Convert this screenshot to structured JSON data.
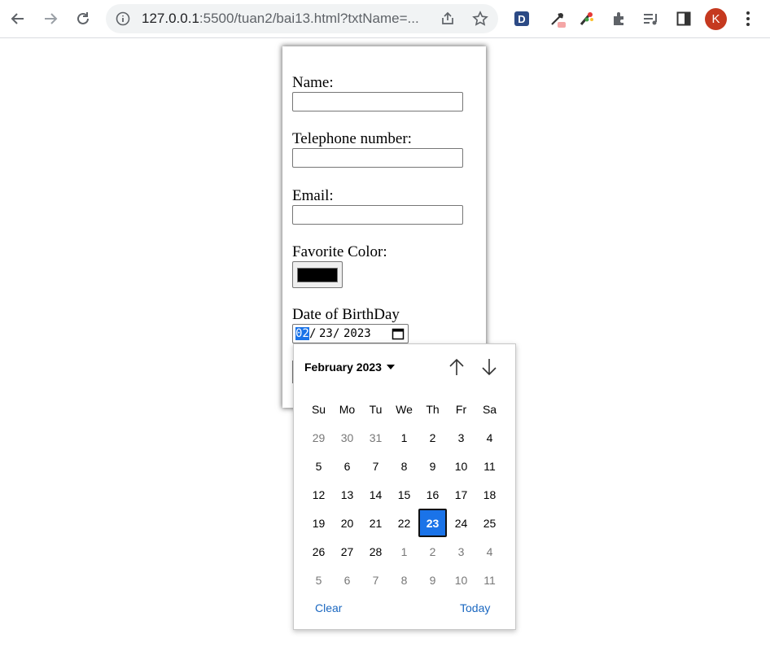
{
  "browser": {
    "url_host": "127.0.0.1",
    "url_rest": ":5500/tuan2/bai13.html?txtName=...",
    "avatar_letter": "K",
    "ext_d_letter": "D"
  },
  "form": {
    "name_label": "Name:",
    "phone_label": "Telephone number:",
    "email_label": "Email:",
    "color_label": "Favorite Color:",
    "color_value": "#000000",
    "dob_label": "Date of BirthDay",
    "dob_month": "02",
    "dob_day": "23",
    "dob_year": "2023",
    "dob_sep": "/"
  },
  "calendar": {
    "month_label": "February 2023",
    "weekdays": [
      "Su",
      "Mo",
      "Tu",
      "We",
      "Th",
      "Fr",
      "Sa"
    ],
    "weeks": [
      [
        {
          "d": "29",
          "o": true
        },
        {
          "d": "30",
          "o": true
        },
        {
          "d": "31",
          "o": true
        },
        {
          "d": "1"
        },
        {
          "d": "2"
        },
        {
          "d": "3"
        },
        {
          "d": "4"
        }
      ],
      [
        {
          "d": "5"
        },
        {
          "d": "6"
        },
        {
          "d": "7"
        },
        {
          "d": "8"
        },
        {
          "d": "9"
        },
        {
          "d": "10"
        },
        {
          "d": "11"
        }
      ],
      [
        {
          "d": "12"
        },
        {
          "d": "13"
        },
        {
          "d": "14"
        },
        {
          "d": "15"
        },
        {
          "d": "16"
        },
        {
          "d": "17"
        },
        {
          "d": "18"
        }
      ],
      [
        {
          "d": "19"
        },
        {
          "d": "20"
        },
        {
          "d": "21"
        },
        {
          "d": "22"
        },
        {
          "d": "23",
          "s": true
        },
        {
          "d": "24"
        },
        {
          "d": "25"
        }
      ],
      [
        {
          "d": "26"
        },
        {
          "d": "27"
        },
        {
          "d": "28"
        },
        {
          "d": "1",
          "o": true
        },
        {
          "d": "2",
          "o": true
        },
        {
          "d": "3",
          "o": true
        },
        {
          "d": "4",
          "o": true
        }
      ],
      [
        {
          "d": "5",
          "o": true
        },
        {
          "d": "6",
          "o": true
        },
        {
          "d": "7",
          "o": true
        },
        {
          "d": "8",
          "o": true
        },
        {
          "d": "9",
          "o": true
        },
        {
          "d": "10",
          "o": true
        },
        {
          "d": "11",
          "o": true
        }
      ]
    ],
    "clear_label": "Clear",
    "today_label": "Today"
  }
}
